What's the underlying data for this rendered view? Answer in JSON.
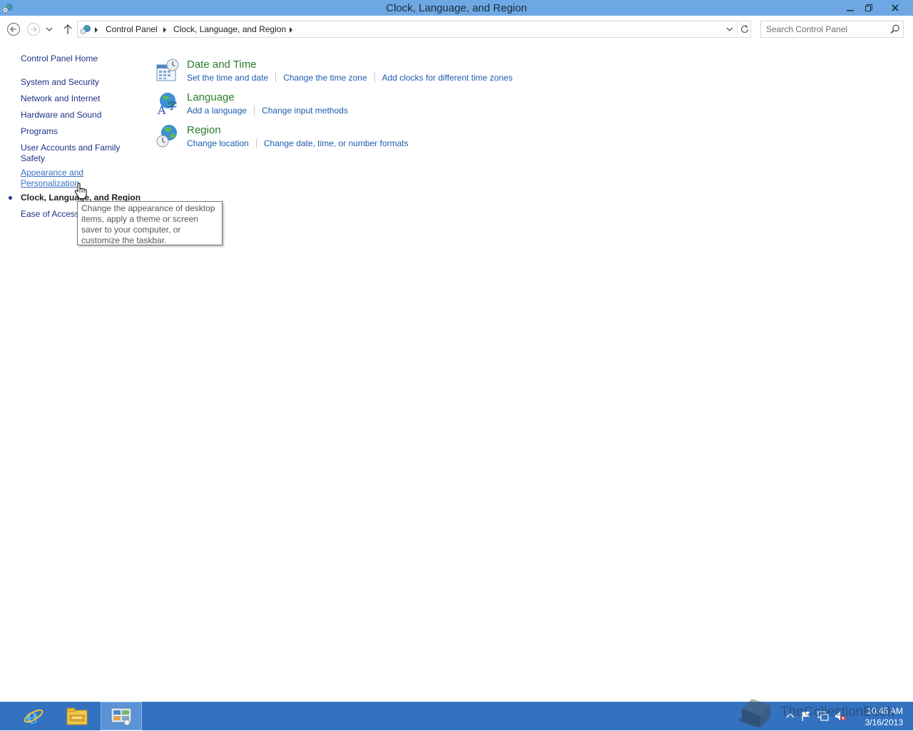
{
  "window": {
    "title": "Clock, Language, and Region"
  },
  "address_bar": {
    "breadcrumbs": [
      "Control Panel",
      "Clock, Language, and Region"
    ],
    "search_placeholder": "Search Control Panel"
  },
  "left_nav": {
    "home": "Control Panel Home",
    "items": [
      {
        "label": "System and Security"
      },
      {
        "label": "Network and Internet"
      },
      {
        "label": "Hardware and Sound"
      },
      {
        "label": "Programs"
      },
      {
        "label": "User Accounts and Family Safety"
      },
      {
        "label": "Appearance and Personalization",
        "state": "hover"
      },
      {
        "label": "Clock, Language, and Region",
        "state": "current"
      },
      {
        "label": "Ease of Access"
      }
    ]
  },
  "categories": [
    {
      "title": "Date and Time",
      "icon": "date-time-icon",
      "links": [
        "Set the time and date",
        "Change the time zone",
        "Add clocks for different time zones"
      ]
    },
    {
      "title": "Language",
      "icon": "language-icon",
      "links": [
        "Add a language",
        "Change input methods"
      ]
    },
    {
      "title": "Region",
      "icon": "region-globe-icon",
      "links": [
        "Change location",
        "Change date, time, or number formats"
      ]
    }
  ],
  "tooltip": {
    "text": "Change the appearance of desktop items, apply a theme or screen saver to your computer, or customize the taskbar."
  },
  "taskbar": {
    "pinned": [
      "internet-explorer-icon",
      "file-explorer-icon",
      "control-panel-icon"
    ],
    "active": "control-panel-icon",
    "clock_time": "10:45 AM",
    "clock_date": "3/16/2013"
  },
  "watermark": {
    "text": "TheCollectionBook"
  },
  "colors": {
    "titlebar": "#6da8e4",
    "taskbar": "#3272c0",
    "category_heading": "#2a7d2a",
    "link": "#1e5bb0",
    "nav_link": "#1e3287"
  }
}
